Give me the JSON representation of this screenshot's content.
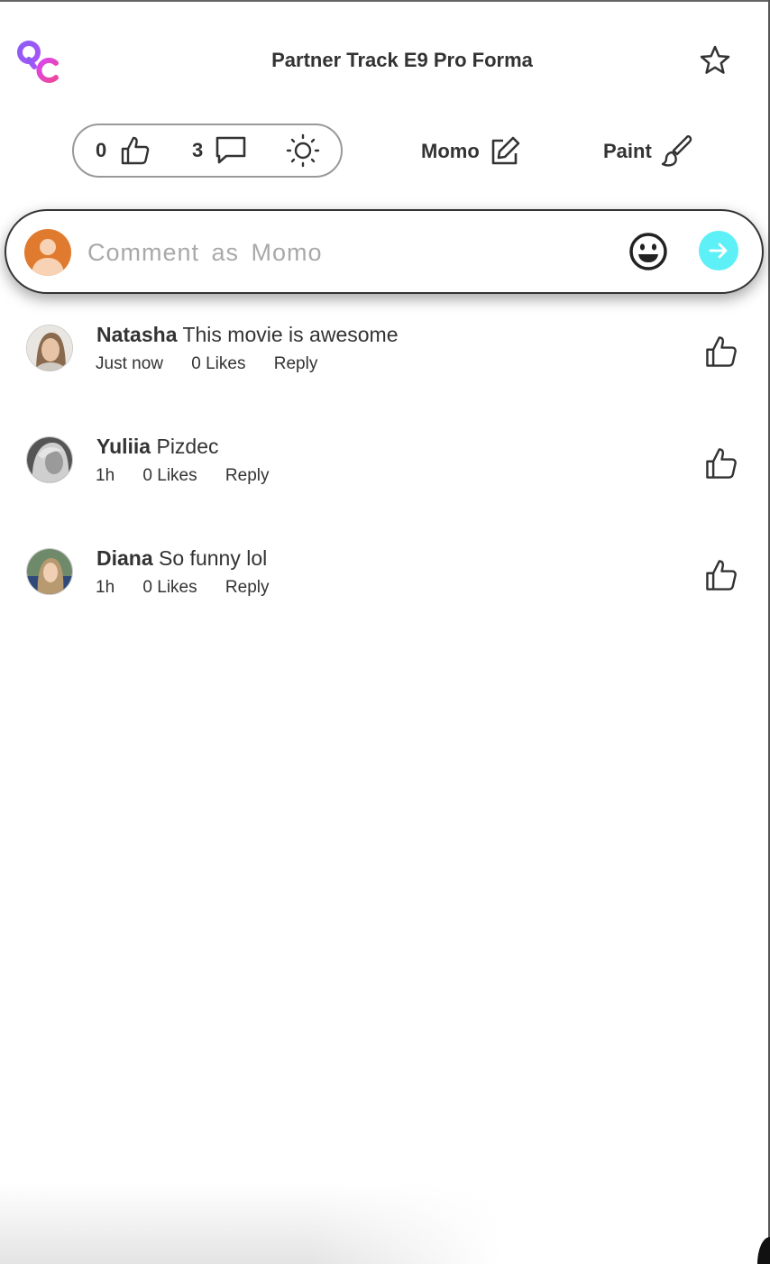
{
  "header": {
    "logo_text": "QC",
    "title": "Partner Track E9 Pro Forma"
  },
  "stats": {
    "likes": "0",
    "comments": "3"
  },
  "actions": {
    "memo_label": "Momo",
    "paint_label": "Paint"
  },
  "composer": {
    "placeholder": "Comment as Momo",
    "value": ""
  },
  "comments": [
    {
      "name": "Natasha",
      "text": "This movie is awesome",
      "time": "Just now",
      "likes": "0 Likes",
      "reply": "Reply"
    },
    {
      "name": "Yuliia",
      "text": "Pizdec",
      "time": "1h",
      "likes": "0 Likes",
      "reply": "Reply"
    },
    {
      "name": "Diana",
      "text": "So funny lol",
      "time": "1h",
      "likes": "0 Likes",
      "reply": "Reply"
    }
  ],
  "icons": {
    "like": "thumbs-up-icon",
    "comment": "speech-bubble-icon",
    "theme": "sun-icon",
    "edit": "pencil-square-icon",
    "paint": "paintbrush-icon",
    "favorite": "star-icon",
    "emoji": "smiley-icon",
    "send": "arrow-right-icon"
  },
  "colors": {
    "send_button": "#5ef0f7",
    "composer_avatar": "#e07a2e",
    "logo_purple": "#8b5cf6",
    "logo_pink": "#ec4899",
    "text": "#333333"
  }
}
